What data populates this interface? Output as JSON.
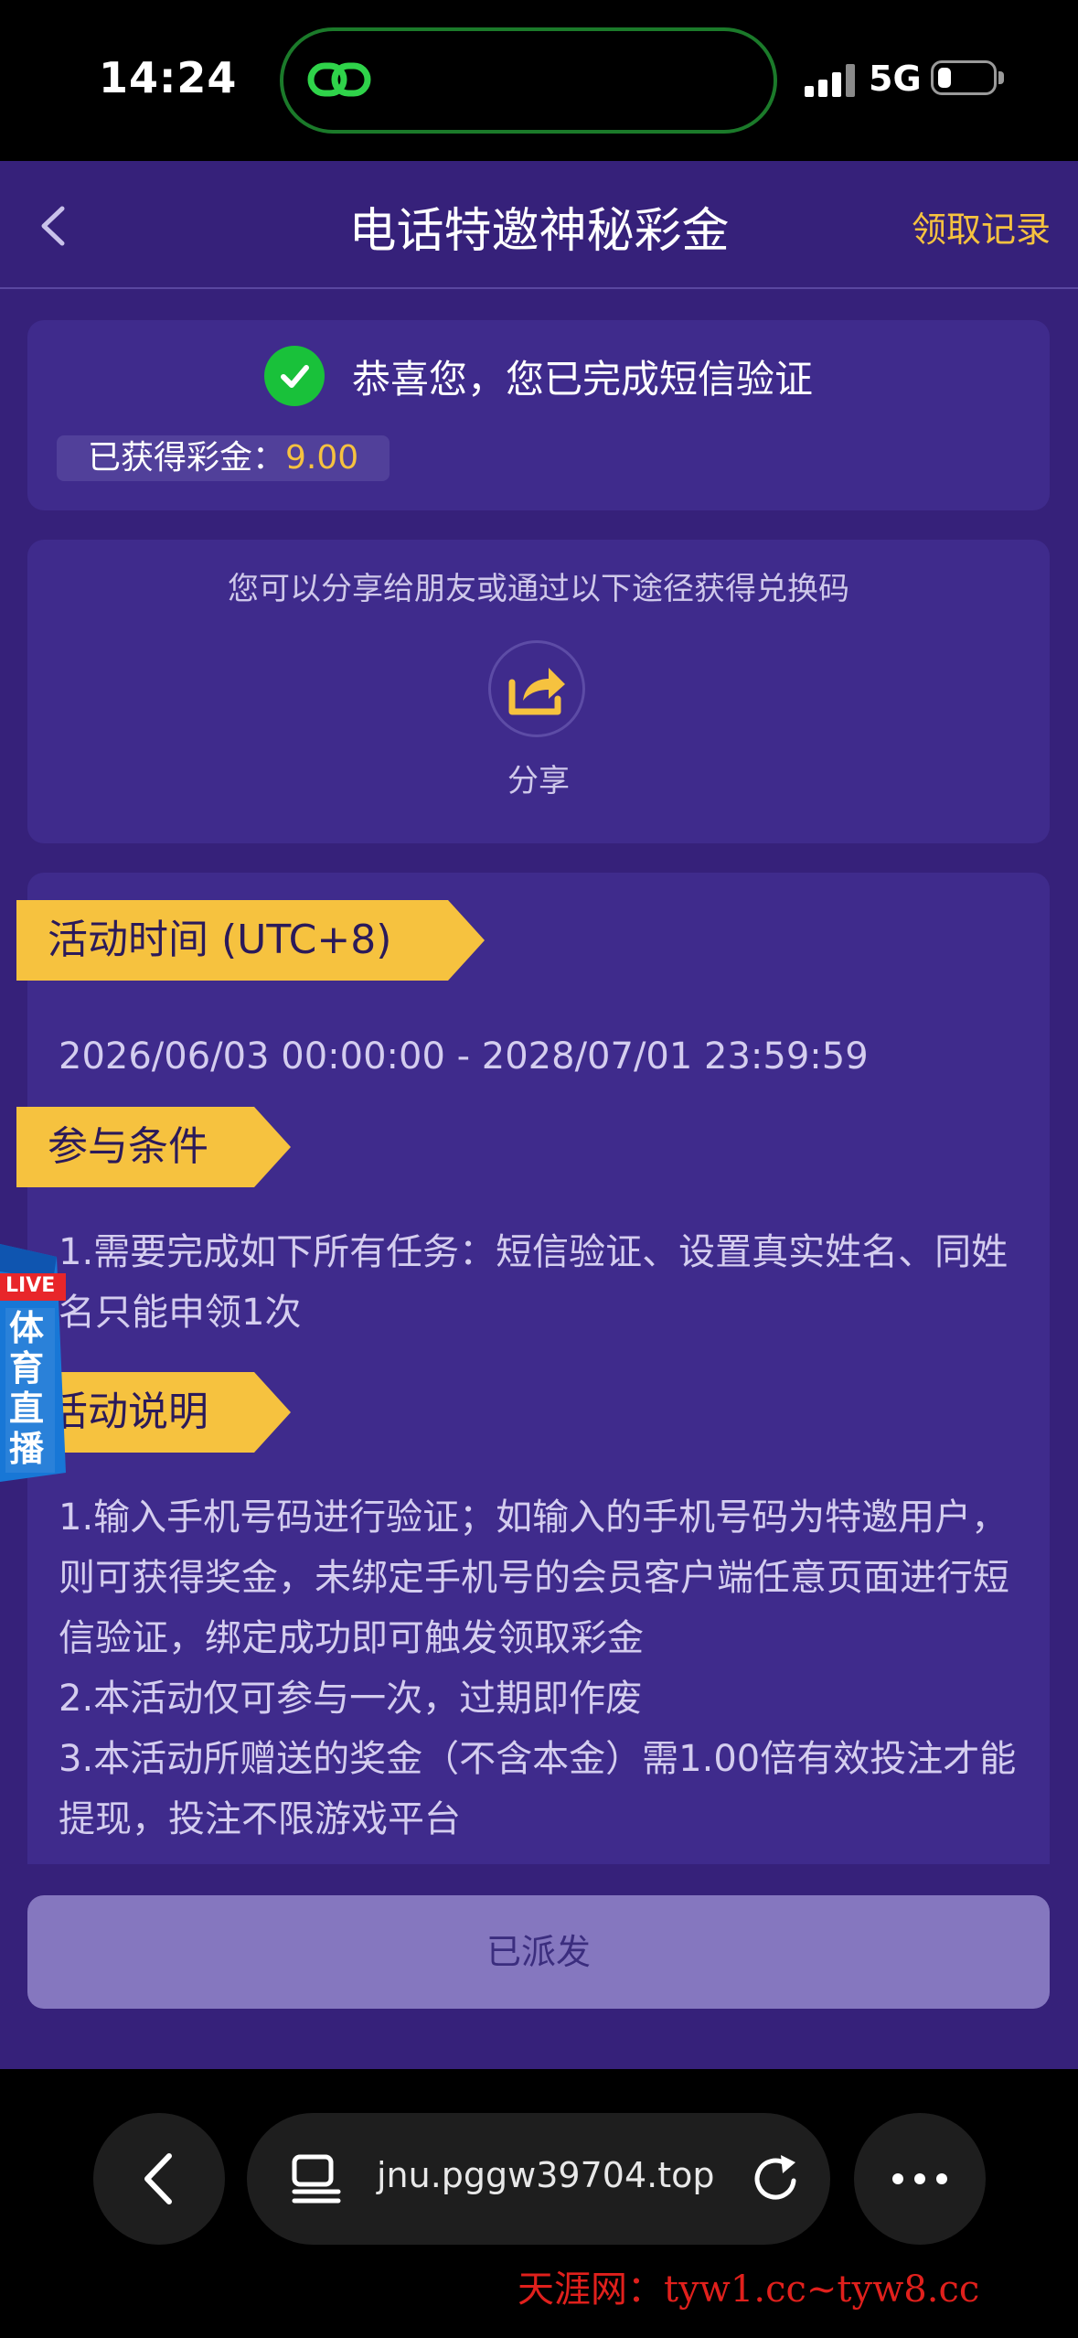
{
  "status_bar": {
    "time": "14:24",
    "network": "5G"
  },
  "header": {
    "title": "电话特邀神秘彩金",
    "records_label": "领取记录"
  },
  "verification": {
    "message": "恭喜您，您已完成短信验证",
    "earned_label": "已获得彩金：",
    "earned_value": "9.00"
  },
  "share": {
    "hint": "您可以分享给朋友或通过以下途径获得兑换码",
    "label": "分享"
  },
  "sections": {
    "time_title": "活动时间 (UTC+8)",
    "time_range": "2026/06/03 00:00:00 - 2028/07/01 23:59:59",
    "conditions_title": "参与条件",
    "conditions_text": "1.需要完成如下所有任务：短信验证、设置真实姓名、同姓名只能申领1次",
    "description_title": "活动说明",
    "description_line1": "1.输入手机号码进行验证；如输入的手机号码为特邀用户，则可获得奖金，未绑定手机号的会员客户端任意页面进行短信验证，绑定成功即可触发领取彩金",
    "description_line2": "2.本活动仅可参与一次，过期即作废",
    "description_line3": "3.本活动所赠送的奖金（不含本金）需1.00倍有效投注才能提现，投注不限游戏平台"
  },
  "live_badge": {
    "tag": "LIVE",
    "text": "体育直播"
  },
  "action_button": "已派发",
  "browser": {
    "url": "jnu.pggw39704.top"
  },
  "watermark": "天涯网：tyw1.cc~tyw8.cc",
  "colors": {
    "app_bg": "#36217a",
    "card_bg": "#3f2b8c",
    "accent_yellow": "#f6c23f",
    "success_green": "#19c13a",
    "button_bg": "#8577bf"
  }
}
